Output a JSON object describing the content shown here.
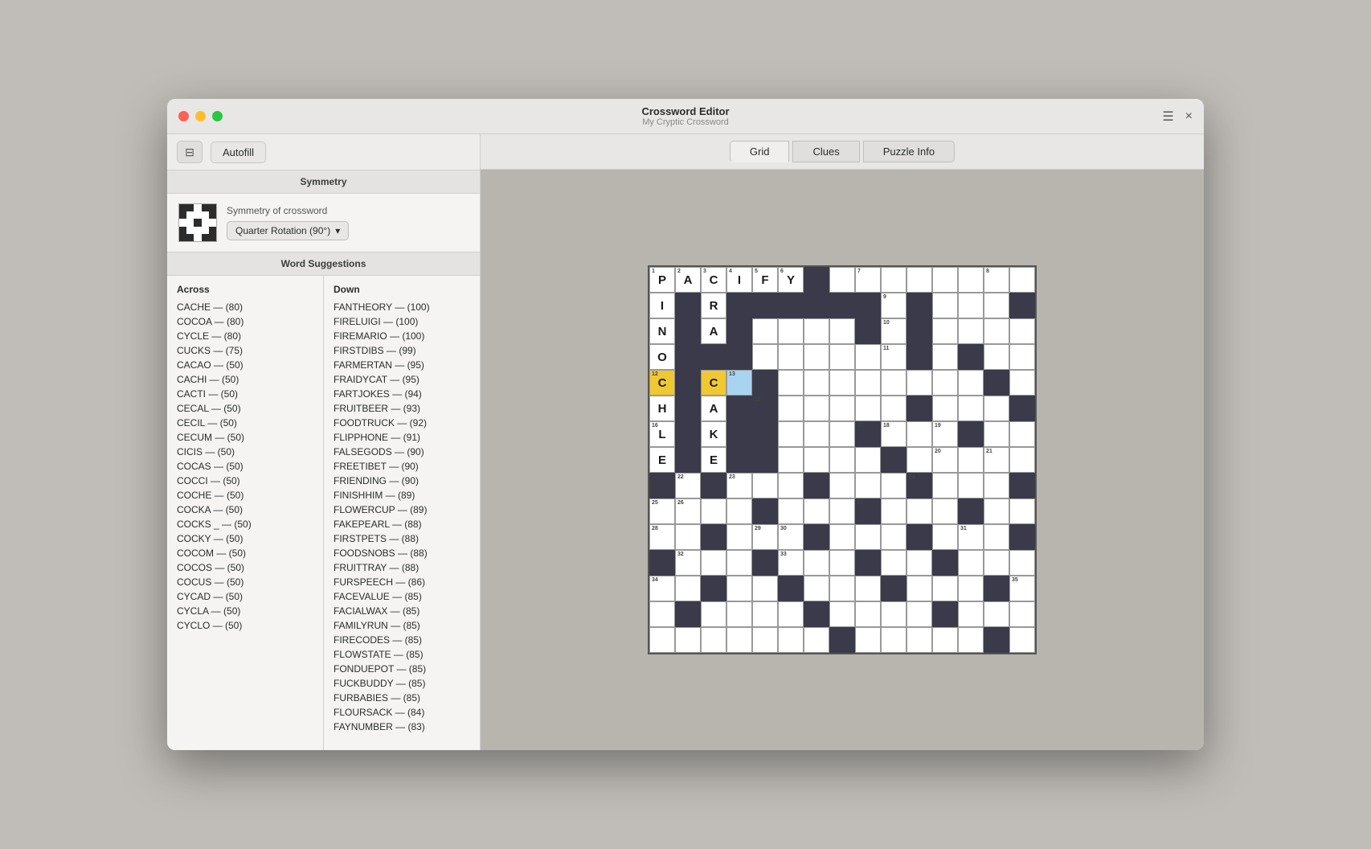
{
  "app": {
    "title": "Crossword Editor",
    "subtitle": "My Cryptic Crossword"
  },
  "titlebar": {
    "close_label": "×",
    "hamburger": "☰"
  },
  "toolbar": {
    "autofill_label": "Autofill"
  },
  "symmetry": {
    "section_label": "Symmetry",
    "description": "Symmetry of crossword",
    "dropdown_label": "Quarter Rotation (90°)",
    "dropdown_arrow": "▾"
  },
  "word_suggestions": {
    "section_label": "Word Suggestions",
    "across_header": "Across",
    "down_header": "Down",
    "across_items": [
      "CACHE — (80)",
      "COCOA — (80)",
      "CYCLE — (80)",
      "CUCKS — (75)",
      "CACAO — (50)",
      "CACHI — (50)",
      "CACTI — (50)",
      "CECAL — (50)",
      "CECIL — (50)",
      "CECUM — (50)",
      "CICIS — (50)",
      "COCAS — (50)",
      "COCCI — (50)",
      "COCHE — (50)",
      "COCKA — (50)",
      "COCKS _ — (50)",
      "COCKY — (50)",
      "COCOM — (50)",
      "COCOS — (50)",
      "COCUS — (50)",
      "CYCAD — (50)",
      "CYCLA — (50)",
      "CYCLO — (50)"
    ],
    "down_items": [
      "FANTHEORY — (100)",
      "FIRELUIGI — (100)",
      "FIREMARIO — (100)",
      "FIRSTDIBS — (99)",
      "FARMERTAN — (95)",
      "FRAIDYCAT — (95)",
      "FARTJOKES — (94)",
      "FRUITBEER — (93)",
      "FOODTRUCK — (92)",
      "FLIPPHONE — (91)",
      "FALSEGODS — (90)",
      "FREETIBET — (90)",
      "FRIENDING — (90)",
      "FINISHHIM — (89)",
      "FLOWERCUP — (89)",
      "FAKEPEARL — (88)",
      "FIRSTPETS — (88)",
      "FOODSNOBS — (88)",
      "FRUITTRAY — (88)",
      "FURSPEECH — (86)",
      "FACEVALUE — (85)",
      "FACIALWAX — (85)",
      "FAMILYRUN — (85)",
      "FIRECODES — (85)",
      "FLOWSTATE — (85)",
      "FONDUEPOT — (85)",
      "FUCKBUDDY — (85)",
      "FURBABIES — (85)",
      "FLOURSACK — (84)",
      "FAYNUMBER — (83)"
    ]
  },
  "tabs": {
    "grid_label": "Grid",
    "clues_label": "Clues",
    "puzzle_info_label": "Puzzle Info"
  },
  "grid": {
    "rows": 15,
    "cols": 15
  }
}
